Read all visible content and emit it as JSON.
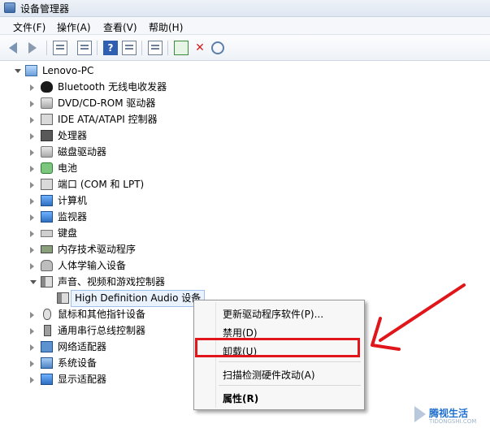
{
  "window": {
    "title": "设备管理器"
  },
  "menu": [
    "文件(F)",
    "操作(A)",
    "查看(V)",
    "帮助(H)"
  ],
  "toolbar": {
    "icons": [
      "back-arrow-icon",
      "forward-arrow-icon",
      "properties-icon",
      "list-view-icon",
      "help-icon",
      "details-icon",
      "scan-hardware-icon",
      "update-driver-icon",
      "disable-device-icon",
      "uninstall-device-icon"
    ]
  },
  "tree": {
    "root": "Lenovo-PC",
    "items": [
      {
        "label": "Bluetooth 无线电收发器",
        "icon": "bluetooth-icon"
      },
      {
        "label": "DVD/CD-ROM 驱动器",
        "icon": "dvd-drive-icon"
      },
      {
        "label": "IDE ATA/ATAPI 控制器",
        "icon": "ide-controller-icon"
      },
      {
        "label": "处理器",
        "icon": "processor-icon"
      },
      {
        "label": "磁盘驱动器",
        "icon": "disk-drive-icon"
      },
      {
        "label": "电池",
        "icon": "battery-icon"
      },
      {
        "label": "端口 (COM 和 LPT)",
        "icon": "port-icon"
      },
      {
        "label": "计算机",
        "icon": "computer-icon"
      },
      {
        "label": "监视器",
        "icon": "monitor-icon"
      },
      {
        "label": "键盘",
        "icon": "keyboard-icon"
      },
      {
        "label": "内存技术驱动程序",
        "icon": "memory-icon"
      },
      {
        "label": "人体学输入设备",
        "icon": "hid-icon"
      },
      {
        "label": "声音、视频和游戏控制器",
        "icon": "speaker-icon"
      },
      {
        "label": "High Definition Audio 设备",
        "icon": "speaker-icon"
      },
      {
        "label": "鼠标和其他指针设备",
        "icon": "mouse-icon"
      },
      {
        "label": "通用串行总线控制器",
        "icon": "usb-icon"
      },
      {
        "label": "网络适配器",
        "icon": "network-icon"
      },
      {
        "label": "系统设备",
        "icon": "system-device-icon"
      },
      {
        "label": "显示适配器",
        "icon": "display-adapter-icon"
      }
    ]
  },
  "context_menu": {
    "items": [
      "更新驱动程序软件(P)...",
      "禁用(D)",
      "卸载(U)",
      "扫描检测硬件改动(A)",
      "属性(R)"
    ],
    "highlighted": "卸载(U)"
  },
  "annotation": {
    "color": "#e0161b"
  },
  "watermark": {
    "text": "腾视生活",
    "sub": "TIDONGSHI.COM"
  }
}
